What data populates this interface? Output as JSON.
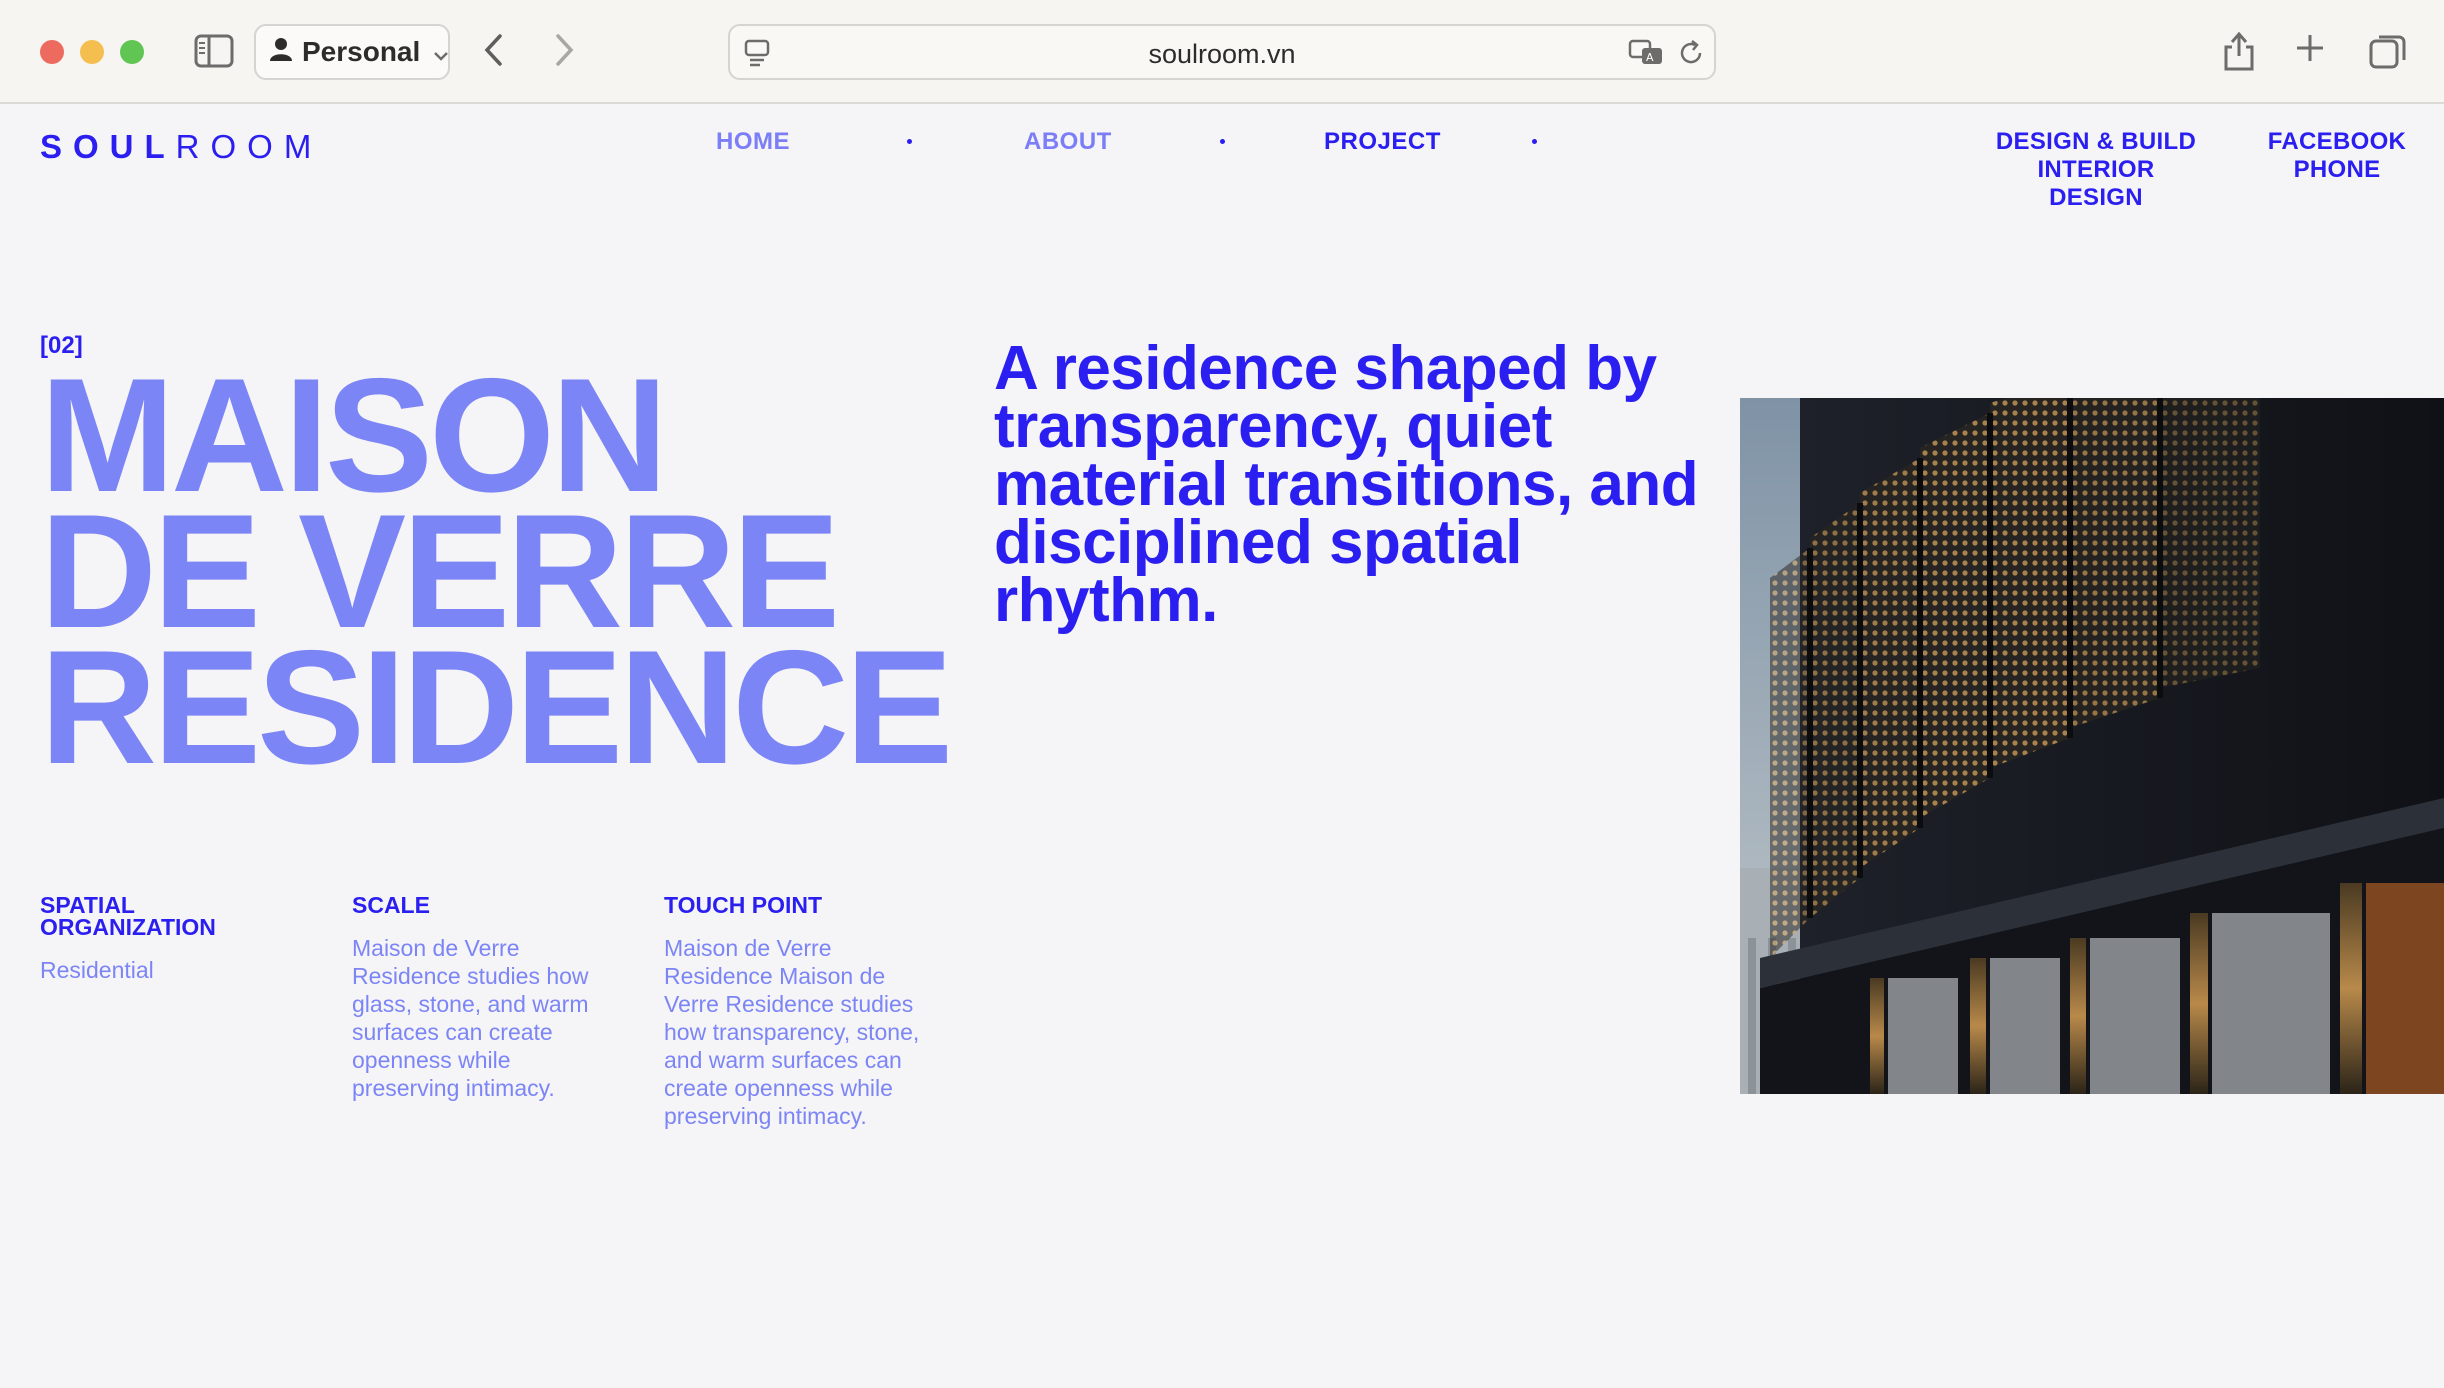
{
  "browser": {
    "profile_label": "Personal",
    "url": "soulroom.vn"
  },
  "site": {
    "logo_bold": "SOUL",
    "logo_light": "ROOM",
    "nav": [
      {
        "label": "HOME"
      },
      {
        "label": "ABOUT"
      },
      {
        "label": "PROJECT"
      }
    ],
    "header_right": {
      "services_line1": "DESIGN & BUILD",
      "services_line2": "INTERIOR DESIGN",
      "contact_line1": "FACEBOOK",
      "contact_line2": "PHONE"
    }
  },
  "project": {
    "index": "[02]",
    "title_line1": "MAISON",
    "title_line2": "DE VERRE",
    "title_line3": "RESIDENCE",
    "tagline": "A residence shaped by transparency, quiet material transitions, and disciplined spatial rhythm.",
    "info": [
      {
        "heading": "SPATIAL ORGANIZATION",
        "body": "Residential"
      },
      {
        "heading": "SCALE",
        "body": "Maison de Verre Residence studies how glass, stone, and warm surfaces can create openness while preserving intimacy."
      },
      {
        "heading": "TOUCH POINT",
        "body": "Maison de Verre Residence Maison de Verre Residence studies how transparency, stone, and warm surfaces can create openness while preserving intimacy."
      }
    ]
  },
  "colors": {
    "brand_blue": "#2a1ff0",
    "soft_blue": "#7c85f6",
    "background": "#f5f4f6"
  }
}
